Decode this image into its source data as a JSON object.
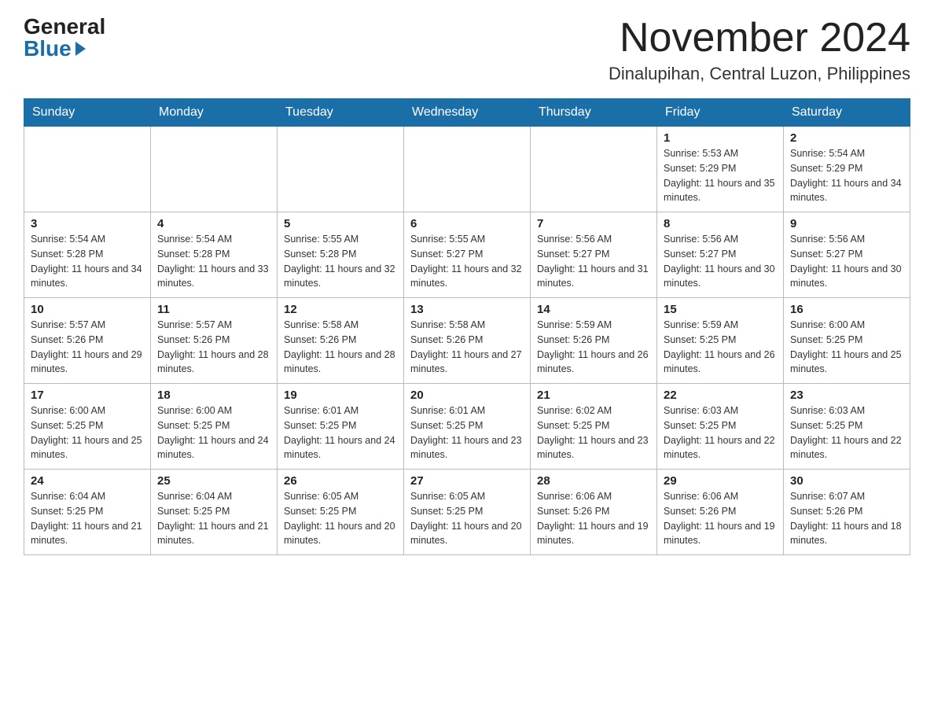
{
  "header": {
    "logo_general": "General",
    "logo_blue": "Blue",
    "month_title": "November 2024",
    "location": "Dinalupihan, Central Luzon, Philippines"
  },
  "weekdays": [
    "Sunday",
    "Monday",
    "Tuesday",
    "Wednesday",
    "Thursday",
    "Friday",
    "Saturday"
  ],
  "weeks": [
    [
      {
        "day": "",
        "info": ""
      },
      {
        "day": "",
        "info": ""
      },
      {
        "day": "",
        "info": ""
      },
      {
        "day": "",
        "info": ""
      },
      {
        "day": "",
        "info": ""
      },
      {
        "day": "1",
        "info": "Sunrise: 5:53 AM\nSunset: 5:29 PM\nDaylight: 11 hours and 35 minutes."
      },
      {
        "day": "2",
        "info": "Sunrise: 5:54 AM\nSunset: 5:29 PM\nDaylight: 11 hours and 34 minutes."
      }
    ],
    [
      {
        "day": "3",
        "info": "Sunrise: 5:54 AM\nSunset: 5:28 PM\nDaylight: 11 hours and 34 minutes."
      },
      {
        "day": "4",
        "info": "Sunrise: 5:54 AM\nSunset: 5:28 PM\nDaylight: 11 hours and 33 minutes."
      },
      {
        "day": "5",
        "info": "Sunrise: 5:55 AM\nSunset: 5:28 PM\nDaylight: 11 hours and 32 minutes."
      },
      {
        "day": "6",
        "info": "Sunrise: 5:55 AM\nSunset: 5:27 PM\nDaylight: 11 hours and 32 minutes."
      },
      {
        "day": "7",
        "info": "Sunrise: 5:56 AM\nSunset: 5:27 PM\nDaylight: 11 hours and 31 minutes."
      },
      {
        "day": "8",
        "info": "Sunrise: 5:56 AM\nSunset: 5:27 PM\nDaylight: 11 hours and 30 minutes."
      },
      {
        "day": "9",
        "info": "Sunrise: 5:56 AM\nSunset: 5:27 PM\nDaylight: 11 hours and 30 minutes."
      }
    ],
    [
      {
        "day": "10",
        "info": "Sunrise: 5:57 AM\nSunset: 5:26 PM\nDaylight: 11 hours and 29 minutes."
      },
      {
        "day": "11",
        "info": "Sunrise: 5:57 AM\nSunset: 5:26 PM\nDaylight: 11 hours and 28 minutes."
      },
      {
        "day": "12",
        "info": "Sunrise: 5:58 AM\nSunset: 5:26 PM\nDaylight: 11 hours and 28 minutes."
      },
      {
        "day": "13",
        "info": "Sunrise: 5:58 AM\nSunset: 5:26 PM\nDaylight: 11 hours and 27 minutes."
      },
      {
        "day": "14",
        "info": "Sunrise: 5:59 AM\nSunset: 5:26 PM\nDaylight: 11 hours and 26 minutes."
      },
      {
        "day": "15",
        "info": "Sunrise: 5:59 AM\nSunset: 5:25 PM\nDaylight: 11 hours and 26 minutes."
      },
      {
        "day": "16",
        "info": "Sunrise: 6:00 AM\nSunset: 5:25 PM\nDaylight: 11 hours and 25 minutes."
      }
    ],
    [
      {
        "day": "17",
        "info": "Sunrise: 6:00 AM\nSunset: 5:25 PM\nDaylight: 11 hours and 25 minutes."
      },
      {
        "day": "18",
        "info": "Sunrise: 6:00 AM\nSunset: 5:25 PM\nDaylight: 11 hours and 24 minutes."
      },
      {
        "day": "19",
        "info": "Sunrise: 6:01 AM\nSunset: 5:25 PM\nDaylight: 11 hours and 24 minutes."
      },
      {
        "day": "20",
        "info": "Sunrise: 6:01 AM\nSunset: 5:25 PM\nDaylight: 11 hours and 23 minutes."
      },
      {
        "day": "21",
        "info": "Sunrise: 6:02 AM\nSunset: 5:25 PM\nDaylight: 11 hours and 23 minutes."
      },
      {
        "day": "22",
        "info": "Sunrise: 6:03 AM\nSunset: 5:25 PM\nDaylight: 11 hours and 22 minutes."
      },
      {
        "day": "23",
        "info": "Sunrise: 6:03 AM\nSunset: 5:25 PM\nDaylight: 11 hours and 22 minutes."
      }
    ],
    [
      {
        "day": "24",
        "info": "Sunrise: 6:04 AM\nSunset: 5:25 PM\nDaylight: 11 hours and 21 minutes."
      },
      {
        "day": "25",
        "info": "Sunrise: 6:04 AM\nSunset: 5:25 PM\nDaylight: 11 hours and 21 minutes."
      },
      {
        "day": "26",
        "info": "Sunrise: 6:05 AM\nSunset: 5:25 PM\nDaylight: 11 hours and 20 minutes."
      },
      {
        "day": "27",
        "info": "Sunrise: 6:05 AM\nSunset: 5:25 PM\nDaylight: 11 hours and 20 minutes."
      },
      {
        "day": "28",
        "info": "Sunrise: 6:06 AM\nSunset: 5:26 PM\nDaylight: 11 hours and 19 minutes."
      },
      {
        "day": "29",
        "info": "Sunrise: 6:06 AM\nSunset: 5:26 PM\nDaylight: 11 hours and 19 minutes."
      },
      {
        "day": "30",
        "info": "Sunrise: 6:07 AM\nSunset: 5:26 PM\nDaylight: 11 hours and 18 minutes."
      }
    ]
  ]
}
